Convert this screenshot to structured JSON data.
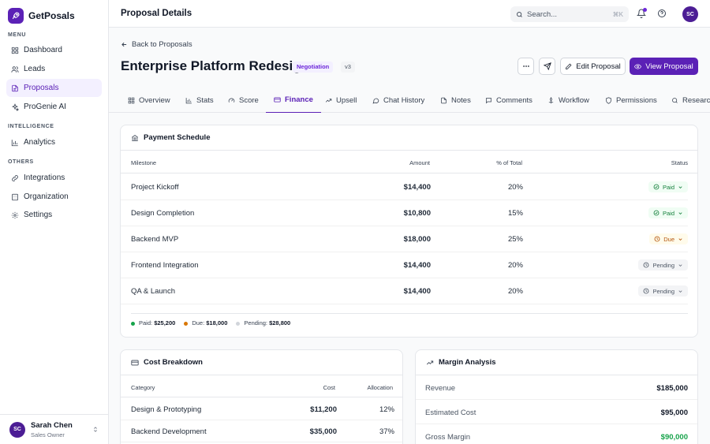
{
  "app": {
    "name": "GetPosals"
  },
  "sidebar": {
    "sections": [
      {
        "label": "MENU"
      },
      {
        "label": "INTELLIGENCE"
      },
      {
        "label": "OTHERS"
      }
    ],
    "items": [
      {
        "label": "Dashboard",
        "icon": "dashboard-icon"
      },
      {
        "label": "Leads",
        "icon": "users-icon"
      },
      {
        "label": "Proposals",
        "icon": "document-icon",
        "active": true
      },
      {
        "label": "ProGenie AI",
        "icon": "sparkle-icon"
      },
      {
        "label": "Analytics",
        "icon": "bar-chart-icon"
      },
      {
        "label": "Integrations",
        "icon": "link-icon"
      },
      {
        "label": "Organization",
        "icon": "building-icon"
      },
      {
        "label": "Settings",
        "icon": "gear-icon"
      }
    ],
    "user": {
      "initials": "SC",
      "name": "Sarah Chen",
      "role": "Sales Owner"
    }
  },
  "topbar": {
    "title": "Proposal Details",
    "search_placeholder": "Search...",
    "search_shortcut": "⌘K",
    "avatar_initials": "SC"
  },
  "proposal": {
    "back_label": "Back to Proposals",
    "title": "Enterprise Platform Redesign",
    "stage": "Negotiation",
    "version": "v3",
    "edit_label": "Edit Proposal",
    "view_label": "View Proposal"
  },
  "tabs": [
    {
      "label": "Overview"
    },
    {
      "label": "Stats"
    },
    {
      "label": "Score"
    },
    {
      "label": "Finance",
      "active": true
    },
    {
      "label": "Upsell"
    },
    {
      "label": "Chat History"
    },
    {
      "label": "Notes"
    },
    {
      "label": "Comments"
    },
    {
      "label": "Workflow"
    },
    {
      "label": "Permissions"
    },
    {
      "label": "Research"
    }
  ],
  "payment_schedule": {
    "title": "Payment Schedule",
    "columns": [
      "Milestone",
      "Amount",
      "% of Total",
      "Status"
    ],
    "rows": [
      {
        "milestone": "Project Kickoff",
        "amount": "$14,400",
        "percent": "20%",
        "status": "Paid"
      },
      {
        "milestone": "Design Completion",
        "amount": "$10,800",
        "percent": "15%",
        "status": "Paid"
      },
      {
        "milestone": "Backend MVP",
        "amount": "$18,000",
        "percent": "25%",
        "status": "Due"
      },
      {
        "milestone": "Frontend Integration",
        "amount": "$14,400",
        "percent": "20%",
        "status": "Pending"
      },
      {
        "milestone": "QA & Launch",
        "amount": "$14,400",
        "percent": "20%",
        "status": "Pending"
      }
    ],
    "summary": {
      "paid_label": "Paid:",
      "paid_value": "$25,200",
      "due_label": "Due:",
      "due_value": "$18,000",
      "pending_label": "Pending:",
      "pending_value": "$28,800"
    }
  },
  "cost_breakdown": {
    "title": "Cost Breakdown",
    "columns": [
      "Category",
      "Cost",
      "Allocation"
    ],
    "rows": [
      {
        "category": "Design & Prototyping",
        "cost": "$11,200",
        "allocation": "12%"
      },
      {
        "category": "Backend Development",
        "cost": "$35,000",
        "allocation": "37%"
      }
    ]
  },
  "margin_analysis": {
    "title": "Margin Analysis",
    "rows": [
      {
        "label": "Revenue",
        "value": "$185,000"
      },
      {
        "label": "Estimated Cost",
        "value": "$95,000"
      },
      {
        "label": "Gross Margin",
        "value": "$90,000"
      }
    ]
  },
  "colors": {
    "brand": "#5b21b6",
    "paid": "#15803d",
    "due": "#b45309",
    "pending": "#6b7280",
    "margin_positive": "#16a34a"
  }
}
